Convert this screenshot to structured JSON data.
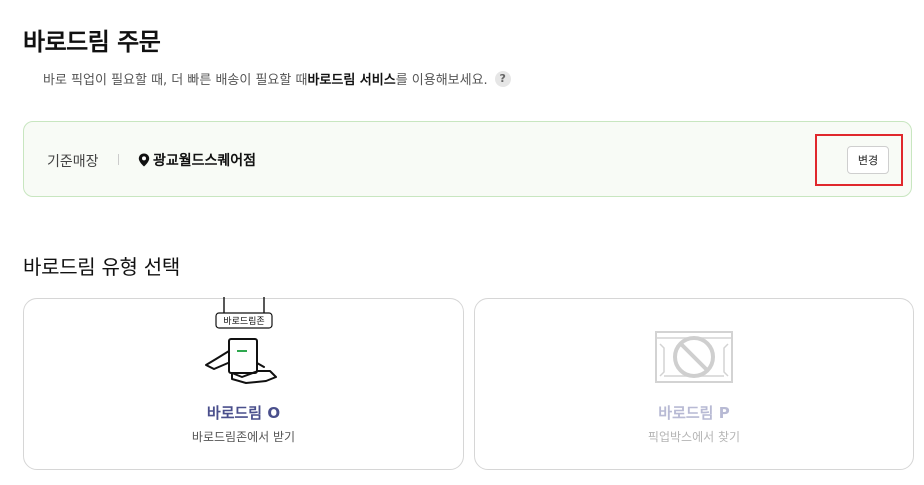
{
  "header": {
    "title": "바로드림 주문",
    "subtitle_prefix": "바로 픽업이 필요할 때, 더 빠른 배송이 필요할 때 ",
    "subtitle_bold": "바로드림 서비스",
    "subtitle_suffix": "를 이용해보세요.",
    "help_label": "?"
  },
  "store": {
    "label": "기준매장",
    "name": "광교월드스퀘어점",
    "change_label": "변경"
  },
  "section": {
    "title": "바로드림 유형 선택"
  },
  "cards": [
    {
      "title": "바로드림 O",
      "desc": "바로드림존에서 받기",
      "zone_tag": "바로드림존"
    },
    {
      "title": "바로드림 P",
      "desc": "픽업박스에서 찾기"
    }
  ],
  "colors": {
    "accent_title": "#4a4f8c",
    "highlight_border": "#e0282d",
    "store_box_border": "#c8e6c0",
    "store_box_bg": "#f8fbf6",
    "green_mark": "#2fa84f"
  }
}
